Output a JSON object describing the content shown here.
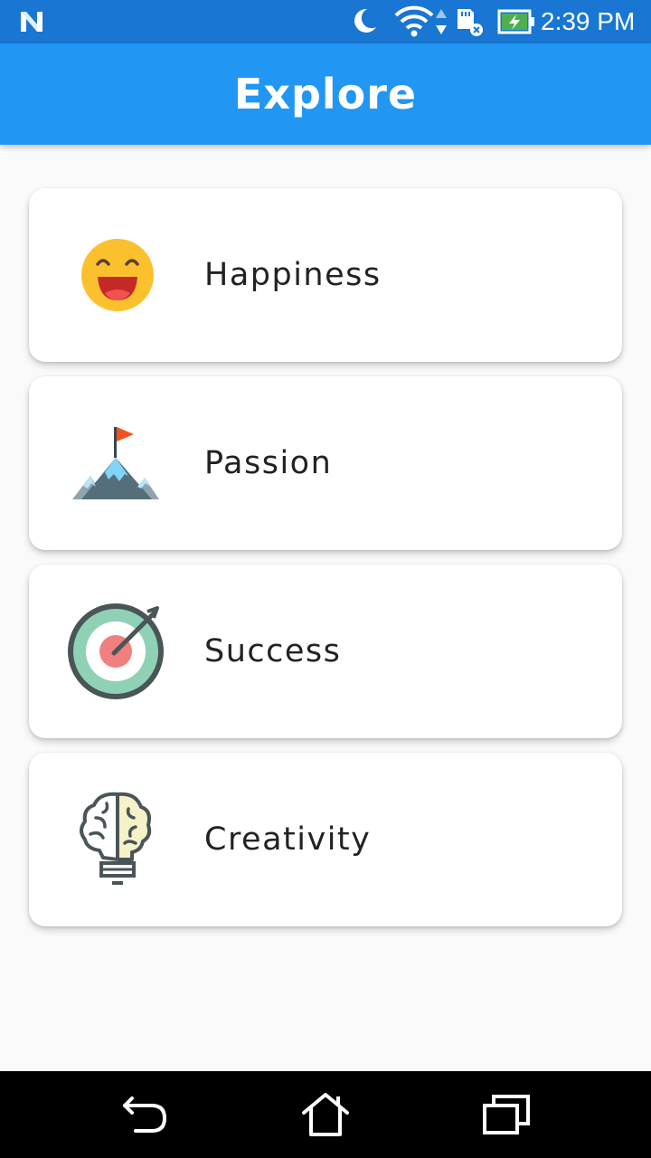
{
  "status_bar": {
    "time": "2:39 PM",
    "icons": [
      "notification-n-icon",
      "do-not-disturb-moon-icon",
      "wifi-icon",
      "data-arrows-icon",
      "sd-card-icon",
      "battery-charging-icon"
    ],
    "bar_color": "#1976d2"
  },
  "app_bar": {
    "title": "Explore",
    "color": "#2196f3"
  },
  "items": [
    {
      "label": "Happiness",
      "icon": "laughing-face-icon"
    },
    {
      "label": "Passion",
      "icon": "mountain-flag-icon"
    },
    {
      "label": "Success",
      "icon": "target-arrow-icon"
    },
    {
      "label": "Creativity",
      "icon": "brain-lightbulb-icon"
    }
  ],
  "nav_bar": {
    "buttons": [
      "back-icon",
      "home-icon",
      "recents-icon"
    ]
  }
}
